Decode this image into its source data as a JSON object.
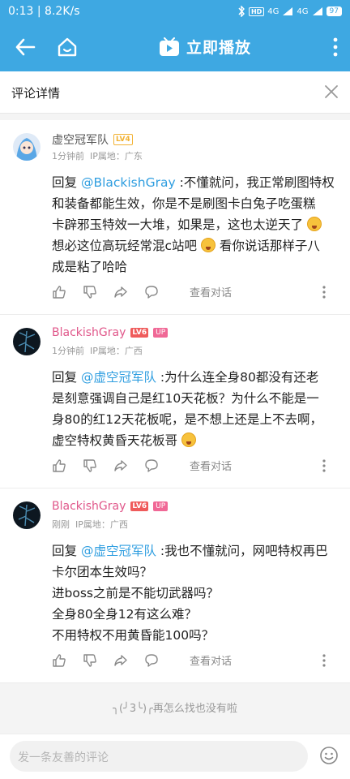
{
  "status_bar": {
    "left_text": "0:13 | 8.2K/s",
    "tag": "HD",
    "net1": "4G",
    "net2": "4G",
    "battery": "97"
  },
  "app_bar": {
    "title": "立即播放",
    "back_icon": "arrow-left-icon",
    "home_icon": "home-icon",
    "more_icon": "more-vertical-icon"
  },
  "title_bar": {
    "title": "评论详情",
    "close_icon": "close-icon"
  },
  "comments": [
    {
      "username": "虚空冠军队",
      "level": "LV4",
      "badge": "",
      "time": "1分钟前",
      "location": "IP属地：广东",
      "reply_prefix": "回复 ",
      "mention": "@BlackishGray",
      "line1_rest": " :不懂就问，我正常刷图特权",
      "line2": "和装备都能生效，你是不是刷图卡白兔子吃蛋糕",
      "line3": "卡辟邪玉特效一大堆，如果是，这也太逆天了",
      "line4a": "想必这位高玩经常混c站吧",
      "line4b": " 看你说话那样子八",
      "line5": "成是粘了哈哈",
      "view_conversation": "查看对话"
    },
    {
      "username": "BlackishGray",
      "level": "LV6",
      "badge": "UP",
      "time": "1分钟前",
      "location": "IP属地：广西",
      "reply_prefix": "回复 ",
      "mention": "@虚空冠军队",
      "line1_rest": " :为什么连全身80都没有还老",
      "line2": "是刻意强调自己是红10天花板？为什么不能是一",
      "line3": "身80的红12天花板呢，是不想上还是上不去啊，",
      "line4": "虚空特权黄昏天花板哥",
      "view_conversation": "查看对话"
    },
    {
      "username": "BlackishGray",
      "level": "LV6",
      "badge": "UP",
      "time": "刚刚",
      "location": "IP属地：广西",
      "reply_prefix": "回复 ",
      "mention": "@虚空冠军队",
      "line1_rest": " :我也不懂就问，网吧特权再巴",
      "line2": "卡尔团本生效吗？",
      "line3": "进boss之前是不能切武器吗？",
      "line4": "全身80全身12有这么难？",
      "line5": "不用特权不用黄昏能100吗？",
      "view_conversation": "查看对话"
    }
  ],
  "footer": {
    "end_text": "╮(╯3╰)╭再怎么找也没有啦"
  },
  "input_bar": {
    "placeholder": "发一条友善的评论",
    "emoji_icon": "smile-icon"
  },
  "colors": {
    "brand_blue": "#3ea8e2",
    "mention_blue": "#2f9ee0",
    "up_pink": "#e0578a"
  }
}
